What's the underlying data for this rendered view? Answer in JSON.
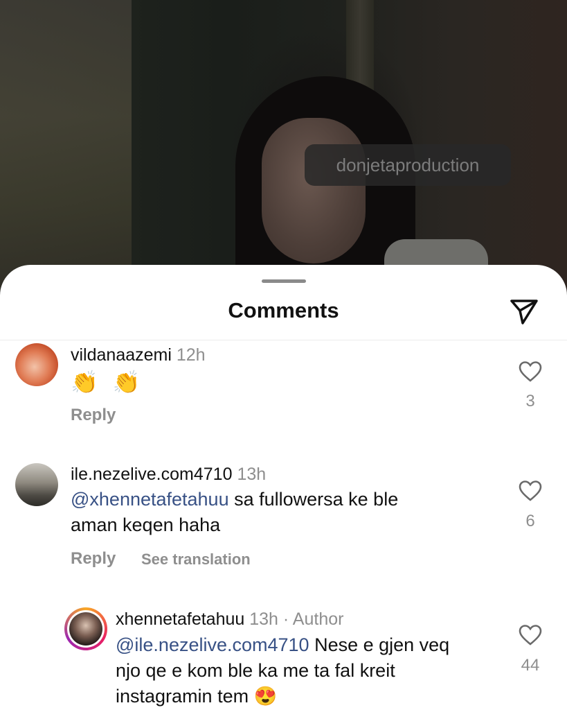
{
  "overlay_tag": "donjetaproduction",
  "sheet": {
    "title": "Comments"
  },
  "comments": [
    {
      "username": "vildanaazemi",
      "time": "12h",
      "text": "👏 👏",
      "reply_label": "Reply",
      "likes": "3"
    },
    {
      "username": "ile.nezelive.com4710",
      "time": "13h",
      "mention": "@xhennetafetahuu",
      "text_line1": " sa fullowersa ke ble",
      "text_line2": "aman keqen haha",
      "reply_label": "Reply",
      "translate_label": "See translation",
      "likes": "6"
    },
    {
      "username": "xhennetafetahuu",
      "time": "13h",
      "author_label": "· Author",
      "mention": "@ile.nezelive.com4710",
      "text_line1": " Nese e gjen veq",
      "text_line2": "njo qe e kom ble ka me ta fal kreit",
      "text_line3": "instagramin tem 😍",
      "likes": "44"
    }
  ],
  "colors": {
    "mention": "#385185",
    "muted": "#8e8e8e"
  },
  "icons": [
    "send-icon",
    "heart-outline-icon"
  ]
}
